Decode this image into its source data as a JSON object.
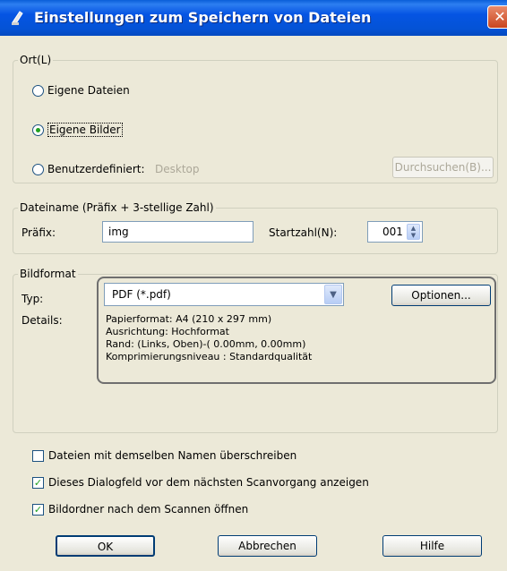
{
  "window": {
    "title": "Einstellungen zum Speichern von Dateien",
    "close_glyph": "✕"
  },
  "ort": {
    "legend": "Ort(L)",
    "options": [
      "Eigene Dateien",
      "Eigene Bilder",
      "Benutzerdefiniert:"
    ],
    "selected_index": 1,
    "custom_path": "Desktop",
    "browse_label": "Durchsuchen(B)..."
  },
  "filename": {
    "legend": "Dateiname (Präfix + 3-stellige Zahl)",
    "prefix_label": "Präfix:",
    "prefix_value": "img",
    "start_label": "Startzahl(N):",
    "start_value": "001"
  },
  "format": {
    "legend": "Bildformat",
    "type_label": "Typ:",
    "type_value": "PDF (*.pdf)",
    "options_button": "Optionen...",
    "details_label": "Details:",
    "details": [
      "Papierformat: A4 (210 x 297 mm)",
      "Ausrichtung: Hochformat",
      "Rand: (Links, Oben)-( 0.00mm, 0.00mm)",
      "Komprimierungsniveau : Standardqualität"
    ]
  },
  "checkboxes": [
    {
      "label": "Dateien mit demselben Namen überschreiben",
      "checked": false
    },
    {
      "label": "Dieses Dialogfeld vor dem nächsten Scanvorgang anzeigen",
      "checked": true
    },
    {
      "label": "Bildordner nach dem Scannen öffnen",
      "checked": true
    }
  ],
  "buttons": {
    "ok": "OK",
    "cancel": "Abbrechen",
    "help": "Hilfe"
  },
  "icons": {
    "title": "scanner-icon",
    "close": "close-icon"
  }
}
